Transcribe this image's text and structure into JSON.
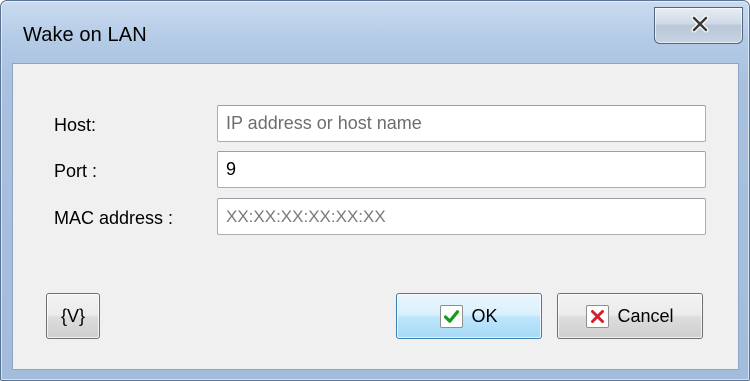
{
  "window": {
    "title": "Wake on LAN"
  },
  "form": {
    "host": {
      "label": "Host:",
      "placeholder": "IP address or host name",
      "value": ""
    },
    "port": {
      "label": "Port :",
      "value": "9"
    },
    "mac": {
      "label": "MAC address :",
      "placeholder": "XX:XX:XX:XX:XX:XX",
      "value": ""
    }
  },
  "buttons": {
    "variables": "{V}",
    "ok": "OK",
    "cancel": "Cancel"
  },
  "icons": {
    "close": "close-icon",
    "ok": "checkmark-icon",
    "cancel": "cross-icon"
  },
  "colors": {
    "ok_check": "#1a9a1a",
    "cancel_cross": "#d3202a"
  }
}
